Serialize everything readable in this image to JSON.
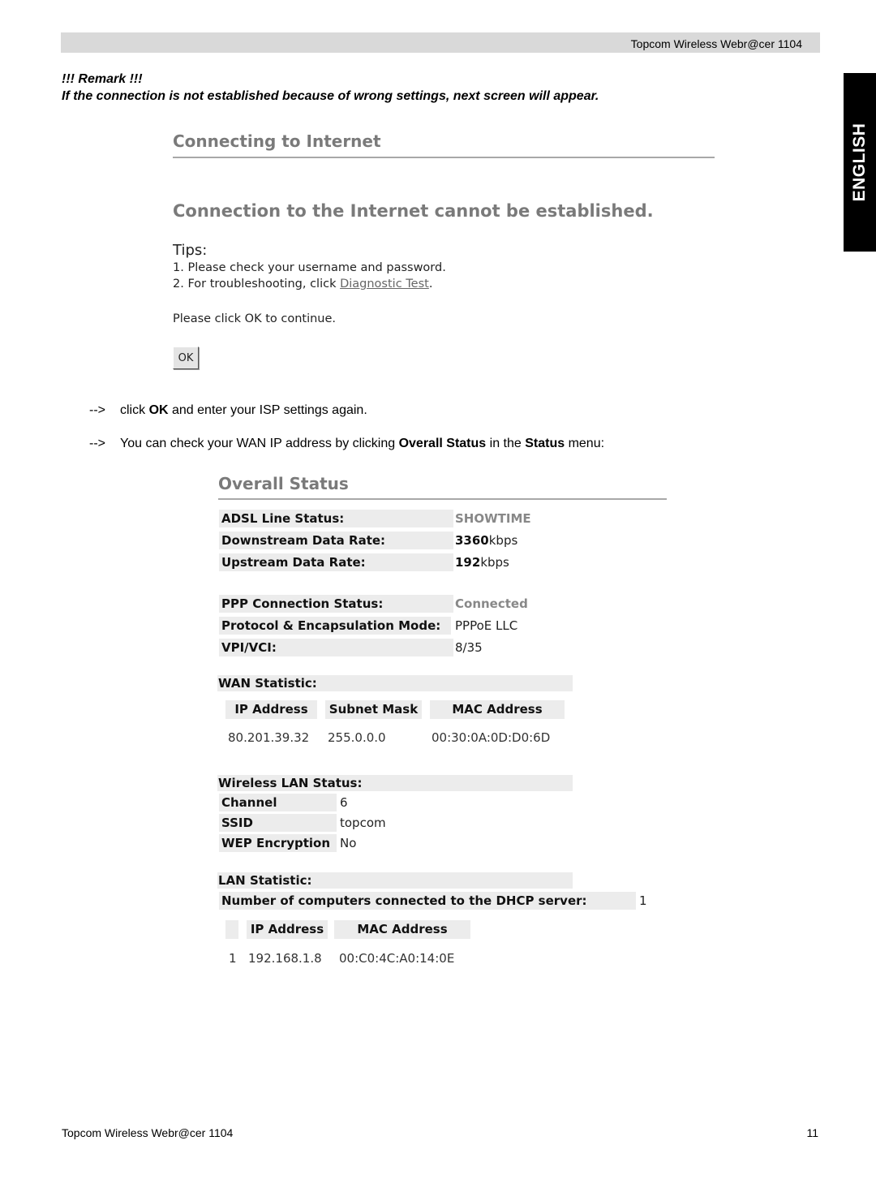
{
  "header": {
    "title": "Topcom Wireless Webr@cer 1104"
  },
  "language_tab": "ENGLISH",
  "remark": {
    "title": "!!! Remark !!!",
    "text": "If the connection is not established because of wrong settings, next screen will appear."
  },
  "connect_screen": {
    "title": "Connecting to Internet",
    "error": "Connection to the Internet cannot be established.",
    "tips_heading": "Tips:",
    "tip1": "1. Please check your username and password.",
    "tip2_prefix": "2. For troubleshooting, click ",
    "tip2_link": "Diagnostic Test",
    "tip2_suffix": ".",
    "continue_text": "Please click OK to continue.",
    "ok_button": "OK"
  },
  "instructions": [
    {
      "arrow": "-->",
      "pre": "click ",
      "b1": "OK",
      "mid": " and enter your ISP settings again.",
      "b2": "",
      "post": ""
    },
    {
      "arrow": "-->",
      "pre": "You can check your WAN IP address by clicking ",
      "b1": "Overall Status",
      "mid": " in the ",
      "b2": "Status",
      "post": " menu:"
    }
  ],
  "overall_status": {
    "title": "Overall Status",
    "adsl": [
      {
        "label": "ADSL Line Status:",
        "value": "SHOWTIME"
      },
      {
        "label": "Downstream Data Rate:",
        "value_num": "3360",
        "value_unit": "kbps"
      },
      {
        "label": "Upstream Data Rate:",
        "value_num": "192",
        "value_unit": "kbps"
      }
    ],
    "ppp": [
      {
        "label": "PPP Connection Status:",
        "value": "Connected"
      },
      {
        "label": "Protocol & Encapsulation Mode:",
        "value": "PPPoE LLC"
      },
      {
        "label": "VPI/VCI:",
        "value": "8/35"
      }
    ],
    "wan": {
      "heading": "WAN Statistic:",
      "columns": [
        "IP Address",
        "Subnet Mask",
        "MAC Address"
      ],
      "row": [
        "80.201.39.32",
        "255.0.0.0",
        "00:30:0A:0D:D0:6D"
      ]
    },
    "wlan": {
      "heading": "Wireless LAN Status:",
      "rows": [
        {
          "label": "Channel",
          "value": "6"
        },
        {
          "label": "SSID",
          "value": "topcom"
        },
        {
          "label": "WEP Encryption",
          "value": "No"
        }
      ]
    },
    "lan": {
      "heading": "LAN Statistic:",
      "dhcp_label": "Number of computers connected to the DHCP server:",
      "dhcp_count": "1",
      "columns": [
        "",
        "IP Address",
        "MAC Address"
      ],
      "row": [
        "1",
        "192.168.1.8",
        "00:C0:4C:A0:14:0E"
      ]
    }
  },
  "footer": {
    "left": "Topcom Wireless Webr@cer 1104",
    "page": "11"
  }
}
